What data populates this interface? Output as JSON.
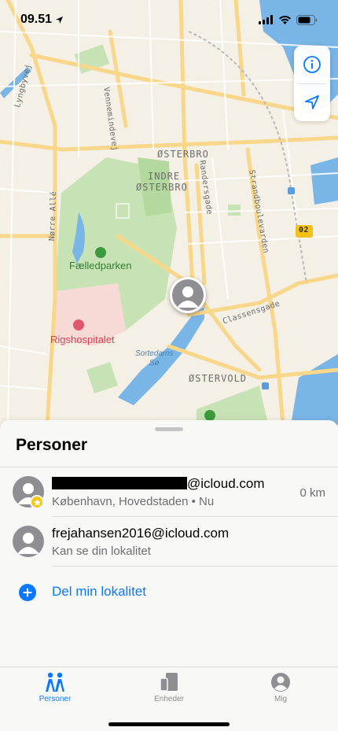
{
  "status_bar": {
    "time": "09.51",
    "icons": [
      "location-arrow-icon",
      "cellular-signal-icon",
      "wifi-icon",
      "battery-icon"
    ]
  },
  "map": {
    "labels": {
      "osterbro": "ØSTERBRO",
      "indre_osterbro_1": "INDRE",
      "indre_osterbro_2": "ØSTERBRO",
      "ostervold": "ØSTERVOLD",
      "faelledparken": "Fælledparken",
      "rigshospitalet": "Rigshospitalet",
      "sortedams_1": "Sortedams",
      "sortedams_2": "Sø",
      "lyngbyvej": "Lyngbyvej",
      "vennemindevej": "Vennemindevej",
      "randersgade": "Randersgade",
      "strandboulevarden": "Strandboulevarden",
      "classensgade": "Classensgade",
      "norre_alle": "Nørre Allé",
      "route_02": "02"
    },
    "controls": {
      "info_icon": "info-icon",
      "locate_icon": "location-arrow-icon"
    }
  },
  "sheet": {
    "title": "Personer",
    "people": [
      {
        "email_suffix": "@icloud.com",
        "email_redacted": true,
        "subtitle": "København, Hovedstaden • Nu",
        "distance": "0 km",
        "badge": "star-badge-icon"
      },
      {
        "email": "frejahansen2016@icloud.com",
        "subtitle": "Kan se din lokalitet"
      }
    ],
    "share_action": "Del min lokalitet"
  },
  "tabs": [
    {
      "label": "Personer",
      "icon": "people-icon",
      "active": true
    },
    {
      "label": "Enheder",
      "icon": "devices-icon",
      "active": false
    },
    {
      "label": "Mig",
      "icon": "person-circle-icon",
      "active": false
    }
  ],
  "colors": {
    "accent": "#0a78ff",
    "inactive_tab": "#8e8e93",
    "park": "#c7e3b5",
    "water": "#79b5e6",
    "road": "#f8d68a"
  }
}
